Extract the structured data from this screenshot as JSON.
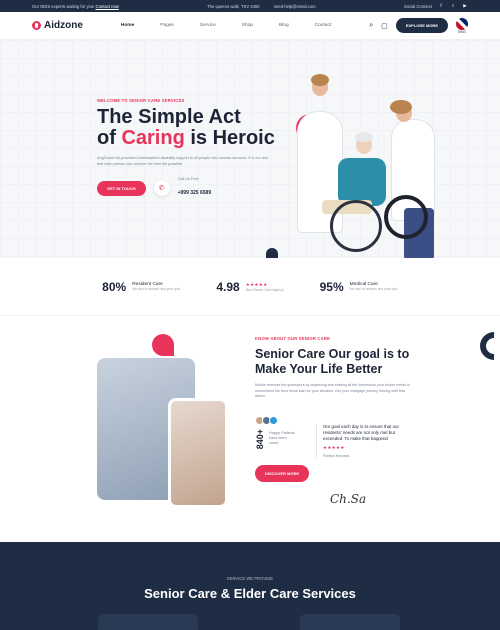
{
  "topbar": {
    "promo": "Our NDIS experts waiting for you!",
    "promo_link": "Contact now",
    "address": "The queens walk, TSV 3466",
    "email": "need-help@email.com",
    "social_label": "Social Connect"
  },
  "nav": {
    "brand": "Aidzone",
    "items": [
      "Home",
      "Pages",
      "Service",
      "Shop",
      "Blog",
      "Contact"
    ],
    "cta": "EXPLORE MORE",
    "lang": "ENG"
  },
  "hero": {
    "eyebrow": "WELCOME TO SENIOR CARE SERVICES",
    "title_line1": "The Simple Act",
    "title_of": "of",
    "title_pink": "Caring",
    "title_rest": "is Heroic",
    "lead": "AngGcare NA provides individualized disability support to all people who access services. It is our aim that each person can achieve the best life possible.",
    "cta": "GET IN TOUCH",
    "call_label": "Call Us Free",
    "phone": "+999 325 6589"
  },
  "stats": [
    {
      "num": "80%",
      "title": "Resident Care",
      "sub": "We aim to answer any your quic"
    },
    {
      "num": "4.98",
      "stars": "★★★★★",
      "sub": "Best Senior Care Agency"
    },
    {
      "num": "95%",
      "title": "Medical Care",
      "sub": "We aim to answer any your quic"
    }
  ],
  "about": {
    "eyebrow": "KNOW ABOUT OUR SENIOR CARE",
    "title": "Senior Care Our goal is to Make Your Life Better",
    "body": "Mobile removes the guesswork by organizing and sharing all the information your broker needs to recommend the best home loan for your situation. Get your mortgage journey moving with less admin.",
    "count": "840+",
    "count_label": "Happy Patients have been cured",
    "quote": "Our goal each day is to ensure that our residents' needs are not only met but exceeded. To make that happend",
    "stars": "★★★★★",
    "author": "Patrick Harvard",
    "cta": "DISCOVER MORE",
    "signature": "Ch.Sa"
  },
  "services": {
    "eyebrow": "SERVICE WE PROVIDE",
    "title": "Senior Care & Elder Care Services"
  }
}
